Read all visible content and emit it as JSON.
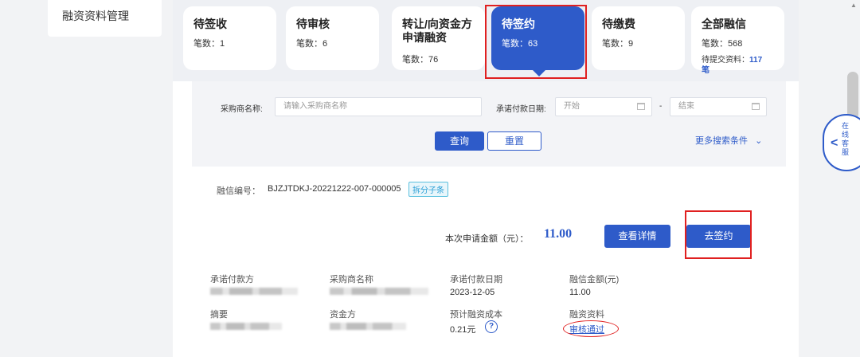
{
  "sidebar": {
    "label": "融资资料管理"
  },
  "tabs": [
    {
      "title": "待签收",
      "count": "笔数：1"
    },
    {
      "title": "待审核",
      "count": "笔数：6"
    },
    {
      "title": "转让/向资金方申请融资",
      "title_line1": "转让/向资金方",
      "title_line2": "申请融资",
      "count": "笔数：76"
    },
    {
      "title": "待签约",
      "count": "笔数：63",
      "active": true
    },
    {
      "title": "待缴费",
      "count": "笔数：9"
    },
    {
      "title": "全部融信",
      "count": "笔数：568",
      "extra_label": "待提交资料：",
      "extra_value": "117",
      "extra_unit": "笔"
    }
  ],
  "search": {
    "buyer_label": "采购商名称:",
    "buyer_placeholder": "请输入采购商名称",
    "date_label": "承诺付款日期:",
    "start_placeholder": "开始",
    "date_separator": "-",
    "end_placeholder": "结束",
    "query_button": "查询",
    "reset_button": "重置",
    "more_conditions": "更多搜索条件",
    "more_chevron": "⌄"
  },
  "record": {
    "id_label": "融信编号：",
    "id_value": "BJZJTDKJ-20221222-007-000005",
    "split_tag": "拆分子条",
    "amount_label": "本次申请金额（元）：",
    "amount_value": "11.00",
    "detail_button": "查看详情",
    "sign_button": "去签约",
    "fields": {
      "payer_label": "承诺付款方",
      "buyer_label": "采购商名称",
      "pay_date_label": "承诺付款日期",
      "pay_date_value": "2023-12-05",
      "credit_amount_label": "融信金额(元)",
      "credit_amount_value": "11.00",
      "summary_label": "摘要",
      "funder_label": "资金方",
      "cost_label": "预计融资成本",
      "cost_value": "0.21元",
      "material_label": "融资资料",
      "material_value": "审核通过"
    }
  },
  "chat": {
    "label": "在线客服",
    "chars": [
      "在",
      "线",
      "客",
      "服"
    ],
    "arrow": "<"
  },
  "colors": {
    "primary": "#2e5bc9",
    "highlight": "#e02020"
  },
  "icons": {
    "calendar": "calendar-icon",
    "help": "question-circle-icon",
    "chevron": "chevron-down-icon"
  }
}
